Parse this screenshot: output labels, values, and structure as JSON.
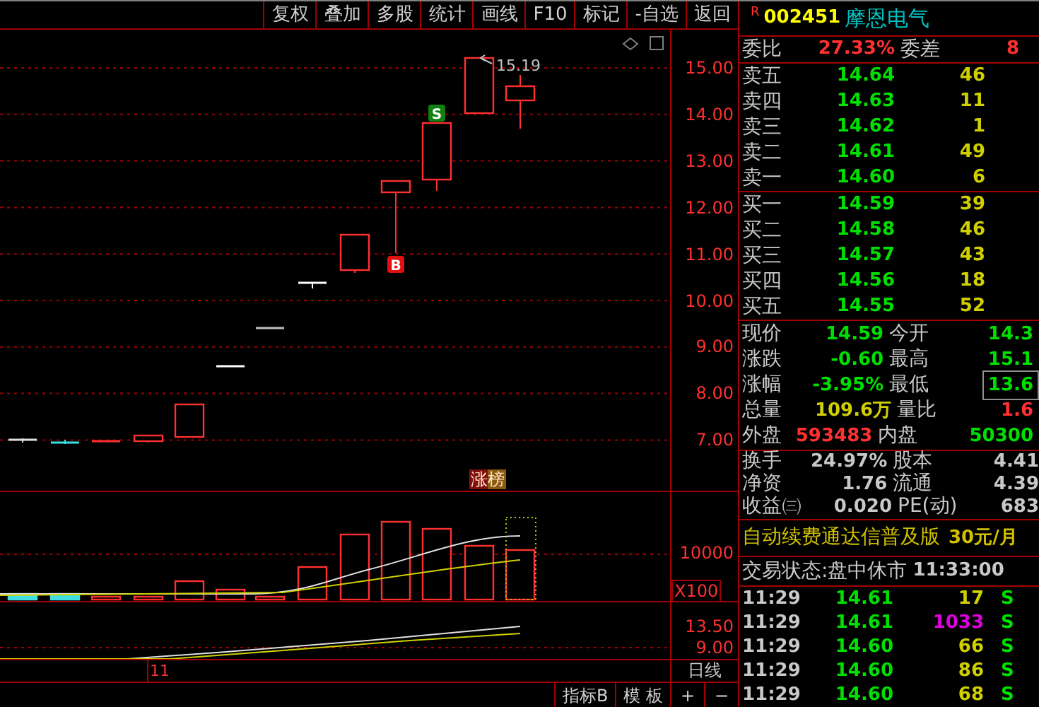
{
  "toolbar": {
    "buttons": [
      "复权",
      "叠加",
      "多股",
      "统计",
      "画线",
      "F10",
      "标记",
      "-自选",
      "返回"
    ]
  },
  "price_chart": {
    "axis_labels": [
      "15.00",
      "14.00",
      "13.00",
      "12.00",
      "11.00",
      "10.00",
      "9.00",
      "8.00",
      "7.00"
    ],
    "high_label": "15.19",
    "markers": [
      {
        "kind": "buy",
        "label": "B"
      },
      {
        "kind": "sell",
        "label": "S"
      }
    ],
    "tag": "涨榜"
  },
  "volume_panel": {
    "axis_label": "10000",
    "unit": "X100"
  },
  "ma_panel": {
    "axis_labels": [
      "13.50",
      "9.00"
    ]
  },
  "date_axis": {
    "label": "11",
    "period": "日线"
  },
  "bottom_tabs": [
    "指标B",
    "模 板",
    "+",
    "−"
  ],
  "quote": {
    "badge": "R",
    "code": "002451",
    "name": "摩恩电气",
    "ratio": {
      "label": "委比",
      "value": "27.33%",
      "label2": "委差",
      "value2": "8"
    },
    "asks": [
      {
        "label": "卖五",
        "price": "14.64",
        "volume": "46"
      },
      {
        "label": "卖四",
        "price": "14.63",
        "volume": "11"
      },
      {
        "label": "卖三",
        "price": "14.62",
        "volume": "1"
      },
      {
        "label": "卖二",
        "price": "14.61",
        "volume": "49"
      },
      {
        "label": "卖一",
        "price": "14.60",
        "volume": "6"
      }
    ],
    "bids": [
      {
        "label": "买一",
        "price": "14.59",
        "volume": "39"
      },
      {
        "label": "买二",
        "price": "14.58",
        "volume": "46"
      },
      {
        "label": "买三",
        "price": "14.57",
        "volume": "43"
      },
      {
        "label": "买四",
        "price": "14.56",
        "volume": "18"
      },
      {
        "label": "买五",
        "price": "14.55",
        "volume": "52"
      }
    ],
    "stats": [
      {
        "left": {
          "label": "现价",
          "value": "14.59",
          "color": "#00e000"
        },
        "right": {
          "label": "今开",
          "value": "14.3",
          "color": "#00e000",
          "boxed": false
        }
      },
      {
        "left": {
          "label": "涨跌",
          "value": "-0.60",
          "color": "#00e000"
        },
        "right": {
          "label": "最高",
          "value": "15.1",
          "color": "#00e000",
          "boxed": false
        }
      },
      {
        "left": {
          "label": "涨幅",
          "value": "-3.95%",
          "color": "#00e000"
        },
        "right": {
          "label": "最低",
          "value": "13.6",
          "color": "#00e000",
          "boxed": true
        }
      },
      {
        "left": {
          "label": "总量",
          "value": "109.6万",
          "color": "#d0d000"
        },
        "right": {
          "label": "量比",
          "value": "1.6",
          "color": "#ff3030",
          "boxed": false
        }
      },
      {
        "left": {
          "label": "外盘",
          "value": "593483",
          "color": "#ff3030"
        },
        "right": {
          "label": "内盘",
          "value": "50300",
          "color": "#00e000",
          "boxed": false
        }
      }
    ],
    "fundamentals": [
      {
        "label": "换手",
        "value": "24.97%",
        "label2": "股本",
        "value2": "4.41"
      },
      {
        "label": "净资",
        "value": "1.76",
        "label2": "流通",
        "value2": "4.39"
      },
      {
        "label": "收益㈢",
        "value": "0.020",
        "label2": "PE(动)",
        "value2": "683"
      }
    ],
    "ad": {
      "text": "自动续费通达信普及版",
      "price": "30元/月"
    },
    "status": {
      "label": "交易状态:盘中休市",
      "time": "11:33:00"
    },
    "ticks": [
      {
        "time": "11:29",
        "price": "14.61",
        "volume": "17",
        "color": "#d0d000",
        "side": "S"
      },
      {
        "time": "11:29",
        "price": "14.61",
        "volume": "1033",
        "color": "#e000e0",
        "side": "S"
      },
      {
        "time": "11:29",
        "price": "14.60",
        "volume": "66",
        "color": "#d0d000",
        "side": "S"
      },
      {
        "time": "11:29",
        "price": "14.60",
        "volume": "86",
        "color": "#d0d000",
        "side": "S"
      },
      {
        "time": "11:29",
        "price": "14.60",
        "volume": "68",
        "color": "#d0d000",
        "side": "S"
      }
    ]
  }
}
